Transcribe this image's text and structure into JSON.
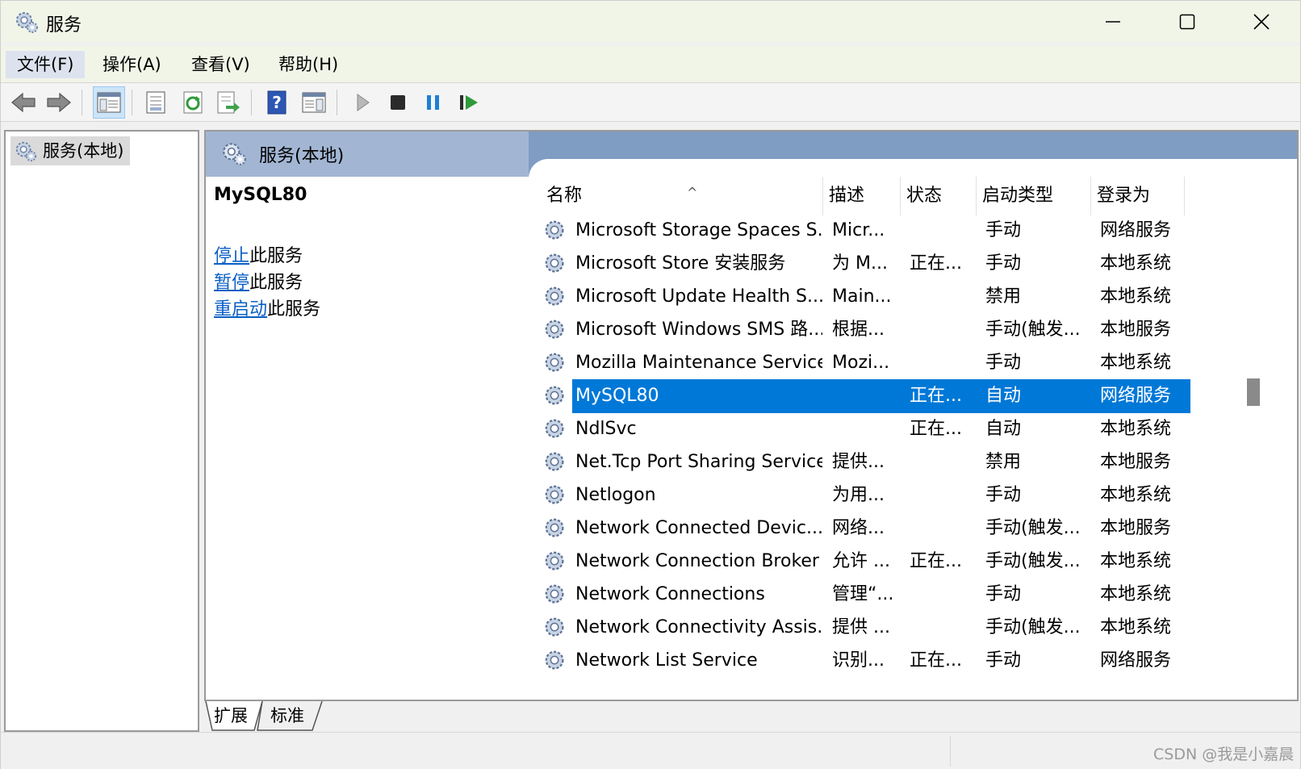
{
  "window": {
    "title": "服务"
  },
  "menu": [
    {
      "label": "文件(F)"
    },
    {
      "label": "操作(A)"
    },
    {
      "label": "查看(V)"
    },
    {
      "label": "帮助(H)"
    }
  ],
  "toolbar": {
    "buttons": [
      {
        "icon": "back-arrow-icon"
      },
      {
        "icon": "forward-arrow-icon"
      },
      {
        "icon": "show-hide-console-tree-icon"
      },
      {
        "icon": "properties-icon"
      },
      {
        "icon": "refresh-icon"
      },
      {
        "icon": "export-list-icon"
      },
      {
        "icon": "help-icon"
      },
      {
        "icon": "show-hide-action-pane-icon"
      },
      {
        "icon": "start-service-icon"
      },
      {
        "icon": "stop-service-icon"
      },
      {
        "icon": "pause-service-icon"
      },
      {
        "icon": "resume-service-icon"
      }
    ]
  },
  "tree": {
    "root_label": "服务(本地)"
  },
  "panel": {
    "header_title": "服务(本地)",
    "selected_service": "MySQL80",
    "actions": [
      {
        "link": "停止",
        "rest": "此服务"
      },
      {
        "link": "暂停",
        "rest": "此服务"
      },
      {
        "link": "重启动",
        "rest": "此服务"
      }
    ]
  },
  "list": {
    "columns": {
      "name": "名称",
      "description": "描述",
      "status": "状态",
      "startup_type": "启动类型",
      "logon_as": "登录为"
    },
    "sort_indicator": "^",
    "rows": [
      {
        "name": "Microsoft Storage Spaces S...",
        "description": "Micr...",
        "status": "",
        "startup": "手动",
        "logon": "网络服务",
        "selected": false
      },
      {
        "name": "Microsoft Store 安装服务",
        "description": "为 M...",
        "status": "正在...",
        "startup": "手动",
        "logon": "本地系统",
        "selected": false
      },
      {
        "name": "Microsoft Update Health S...",
        "description": "Main...",
        "status": "",
        "startup": "禁用",
        "logon": "本地系统",
        "selected": false
      },
      {
        "name": "Microsoft Windows SMS 路...",
        "description": "根据...",
        "status": "",
        "startup": "手动(触发...",
        "logon": "本地服务",
        "selected": false
      },
      {
        "name": "Mozilla Maintenance Service",
        "description": "Mozi...",
        "status": "",
        "startup": "手动",
        "logon": "本地系统",
        "selected": false
      },
      {
        "name": "MySQL80",
        "description": "",
        "status": "正在...",
        "startup": "自动",
        "logon": "网络服务",
        "selected": true
      },
      {
        "name": "NdlSvc",
        "description": "",
        "status": "正在...",
        "startup": "自动",
        "logon": "本地系统",
        "selected": false
      },
      {
        "name": "Net.Tcp Port Sharing Service",
        "description": "提供...",
        "status": "",
        "startup": "禁用",
        "logon": "本地服务",
        "selected": false
      },
      {
        "name": "Netlogon",
        "description": "为用...",
        "status": "",
        "startup": "手动",
        "logon": "本地系统",
        "selected": false
      },
      {
        "name": "Network Connected Devic...",
        "description": "网络...",
        "status": "",
        "startup": "手动(触发...",
        "logon": "本地服务",
        "selected": false
      },
      {
        "name": "Network Connection Broker",
        "description": "允许 ...",
        "status": "正在...",
        "startup": "手动(触发...",
        "logon": "本地系统",
        "selected": false
      },
      {
        "name": "Network Connections",
        "description": "管理“...",
        "status": "",
        "startup": "手动",
        "logon": "本地系统",
        "selected": false
      },
      {
        "name": "Network Connectivity Assis...",
        "description": "提供 ...",
        "status": "",
        "startup": "手动(触发...",
        "logon": "本地系统",
        "selected": false
      },
      {
        "name": "Network List Service",
        "description": "识别...",
        "status": "正在...",
        "startup": "手动",
        "logon": "网络服务",
        "selected": false
      }
    ]
  },
  "tabs": [
    {
      "label": "扩展",
      "active": true
    },
    {
      "label": "标准",
      "active": false
    }
  ],
  "status_bar": {
    "watermark": "CSDN @我是小嘉晨"
  },
  "colors": {
    "selection": "#0078d7",
    "header_band": "#7f9cc3",
    "link": "#0a5fc4",
    "title_bar": "#f1f5e8"
  }
}
